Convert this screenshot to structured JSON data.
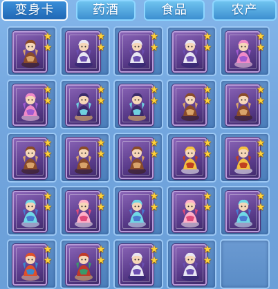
{
  "tabs": [
    {
      "label": "变身卡",
      "active": true
    },
    {
      "label": "药酒",
      "active": false
    },
    {
      "label": "食品",
      "active": false
    },
    {
      "label": "农产",
      "active": false
    }
  ],
  "colors": {
    "panel_bg": "#73a6de",
    "tab_active": "#1f67b5",
    "tab_inactive": "#3d8fd0",
    "card_frame": "#5b3c8c",
    "star": "#ffd23a"
  },
  "slots": [
    {
      "item": "transform-card",
      "figure": "brown-beast-rider",
      "stars": 2
    },
    {
      "item": "transform-card",
      "figure": "purple-armored-warrior",
      "stars": 2
    },
    {
      "item": "transform-card",
      "figure": "purple-armored-warrior",
      "stars": 2
    },
    {
      "item": "transform-card",
      "figure": "purple-armored-warrior",
      "stars": 2
    },
    {
      "item": "transform-card",
      "figure": "pink-haired-dancer",
      "stars": 2
    },
    {
      "item": "transform-card",
      "figure": "pink-haired-dancer",
      "stars": 2
    },
    {
      "item": "transform-card",
      "figure": "dark-unicorn",
      "stars": 2
    },
    {
      "item": "transform-card",
      "figure": "dark-unicorn",
      "stars": 2
    },
    {
      "item": "transform-card",
      "figure": "brown-beast-rider",
      "stars": 2
    },
    {
      "item": "transform-card",
      "figure": "brown-beast-rider",
      "stars": 2
    },
    {
      "item": "transform-card",
      "figure": "brown-beast-rider",
      "stars": 2
    },
    {
      "item": "transform-card",
      "figure": "brown-beast-rider",
      "stars": 2
    },
    {
      "item": "transform-card",
      "figure": "brown-beast-rider",
      "stars": 2
    },
    {
      "item": "transform-card",
      "figure": "golden-warrior",
      "stars": 2
    },
    {
      "item": "transform-card",
      "figure": "golden-warrior",
      "stars": 2
    },
    {
      "item": "transform-card",
      "figure": "cyan-spirit",
      "stars": 2
    },
    {
      "item": "transform-card",
      "figure": "pink-fairy",
      "stars": 2
    },
    {
      "item": "transform-card",
      "figure": "cyan-spirit",
      "stars": 2
    },
    {
      "item": "transform-card",
      "figure": "pink-fairy",
      "stars": 2
    },
    {
      "item": "transform-card",
      "figure": "cyan-spirit",
      "stars": 2
    },
    {
      "item": "transform-card",
      "figure": "red-haired-fighter",
      "stars": 2
    },
    {
      "item": "transform-card",
      "figure": "red-masked-warrior",
      "stars": 2
    },
    {
      "item": "transform-card",
      "figure": "purple-armored-warrior",
      "stars": 2
    },
    {
      "item": "transform-card",
      "figure": "purple-armored-warrior",
      "stars": 2
    },
    {
      "item": "empty",
      "figure": "",
      "stars": 0
    }
  ]
}
